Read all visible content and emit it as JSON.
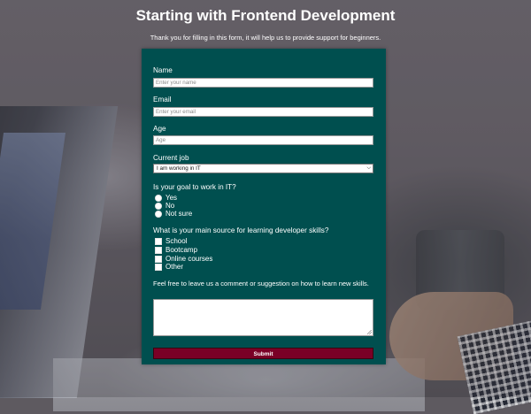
{
  "page": {
    "title": "Starting with Frontend Development",
    "description": "Thank you for filling in this form, it will help us to provide support for beginners."
  },
  "form": {
    "name": {
      "label": "Name",
      "placeholder": "Enter your name"
    },
    "email": {
      "label": "Email",
      "placeholder": "Enter your email"
    },
    "age": {
      "label": "Age",
      "placeholder": "Age"
    },
    "current_job": {
      "label": "Current job",
      "selected": "I am working in IT"
    },
    "goal": {
      "label": "Is your goal to work in IT?",
      "options": [
        "Yes",
        "No",
        "Not sure"
      ]
    },
    "source": {
      "label": "What is your main source for learning developer skills?",
      "options": [
        "School",
        "Bootcamp",
        "Online courses",
        "Other"
      ]
    },
    "comment": {
      "label": "Feel free to leave us a comment or suggestion on how to learn new skills."
    },
    "submit_label": "Submit"
  },
  "colors": {
    "form_background": "#004f4f",
    "submit_background": "#7a0026",
    "text": "#ffffff"
  },
  "icons": {
    "select_arrow": "chevron-down-icon",
    "textarea_grip": "resize-grip-icon"
  }
}
